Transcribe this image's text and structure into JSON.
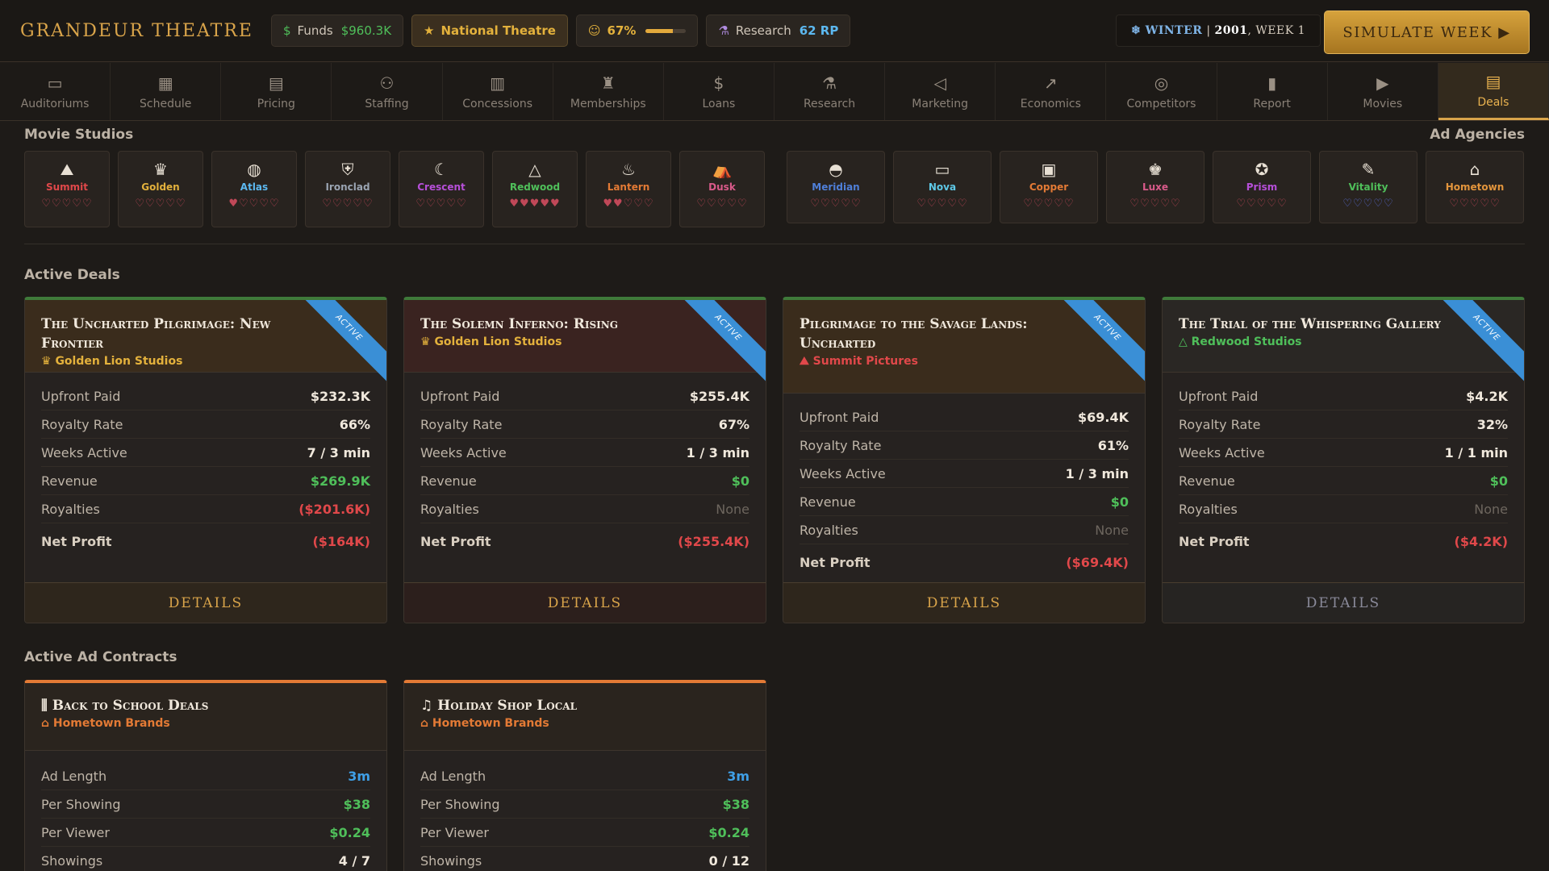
{
  "header": {
    "brand": "GRANDEUR THEATRE",
    "funds_label": "Funds",
    "funds_value": "$960.3K",
    "tier": "National Theatre",
    "satisfaction": "67%",
    "satisfaction_level": 0.67,
    "research_label": "Research",
    "research_value": "62 RP",
    "season": "WINTER",
    "year": "2001",
    "week": ", WEEK 1",
    "simulate_label": "SIMULATE WEEK ▶"
  },
  "nav": [
    {
      "label": "Auditoriums",
      "icon": "sofa-icon"
    },
    {
      "label": "Schedule",
      "icon": "calendar-icon"
    },
    {
      "label": "Pricing",
      "icon": "ticket-icon"
    },
    {
      "label": "Staffing",
      "icon": "people-icon"
    },
    {
      "label": "Concessions",
      "icon": "popcorn-icon"
    },
    {
      "label": "Memberships",
      "icon": "medal-icon"
    },
    {
      "label": "Loans",
      "icon": "dollar-icon"
    },
    {
      "label": "Research",
      "icon": "flask-icon"
    },
    {
      "label": "Marketing",
      "icon": "megaphone-icon"
    },
    {
      "label": "Economics",
      "icon": "chart-icon"
    },
    {
      "label": "Competitors",
      "icon": "target-icon"
    },
    {
      "label": "Report",
      "icon": "bars-icon"
    },
    {
      "label": "Movies",
      "icon": "play-icon"
    },
    {
      "label": "Deals",
      "icon": "document-icon",
      "active": true
    }
  ],
  "sections": {
    "studios": "Movie Studios",
    "agencies": "Ad Agencies",
    "deals": "Active Deals",
    "contracts": "Active Ad Contracts"
  },
  "studios": [
    {
      "name": "Summit",
      "color": "#e0484a",
      "hearts": "♡♡♡♡♡"
    },
    {
      "name": "Golden",
      "color": "#e3b13c",
      "hearts": "♡♡♡♡♡"
    },
    {
      "name": "Atlas",
      "color": "#5cb8f0",
      "hearts": "♥♡♡♡♡"
    },
    {
      "name": "Ironclad",
      "color": "#9aa4b2",
      "hearts": "♡♡♡♡♡"
    },
    {
      "name": "Crescent",
      "color": "#b64fd8",
      "hearts": "♡♡♡♡♡"
    },
    {
      "name": "Redwood",
      "color": "#4fbf5a",
      "hearts": "♥♥♥♥♥"
    },
    {
      "name": "Lantern",
      "color": "#e37a35",
      "hearts": "♥♥♡♡♡"
    },
    {
      "name": "Dusk",
      "color": "#d95a8a",
      "hearts": "♡♡♡♡♡"
    }
  ],
  "agencies": [
    {
      "name": "Meridian",
      "color": "#4f7fd8",
      "hearts": "♡♡♡♡♡"
    },
    {
      "name": "Nova",
      "color": "#5ec8e6",
      "hearts": "♡♡♡♡♡"
    },
    {
      "name": "Copper",
      "color": "#e37a35",
      "hearts": "♡♡♡♡♡"
    },
    {
      "name": "Luxe",
      "color": "#d95a8a",
      "hearts": "♡♡♡♡♡"
    },
    {
      "name": "Prism",
      "color": "#b64fd8",
      "hearts": "♡♡♡♡♡"
    },
    {
      "name": "Vitality",
      "color": "#4fbf5a",
      "hearts": "♡♡♡♡♡"
    },
    {
      "name": "Hometown",
      "color": "#e3953c",
      "hearts": "♡♡♡♡♡"
    }
  ],
  "deals": [
    {
      "title": "The Uncharted Pilgrimage: New Frontier",
      "studio": "Golden Lion Studios",
      "ribbon": "ACTIVE",
      "rows": [
        [
          "Upfront Paid",
          "$232.3K"
        ],
        [
          "Royalty Rate",
          "66%"
        ],
        [
          "Weeks Active",
          "7 / 3 min"
        ],
        [
          "Revenue",
          "$269.9K"
        ],
        [
          "Royalties",
          "($201.6K)"
        ]
      ],
      "net_label": "Net Profit",
      "net_value": "($164K)",
      "details": "DETAILS"
    },
    {
      "title": "The Solemn Inferno: Rising",
      "studio": "Golden Lion Studios",
      "ribbon": "ACTIVE",
      "rows": [
        [
          "Upfront Paid",
          "$255.4K"
        ],
        [
          "Royalty Rate",
          "67%"
        ],
        [
          "Weeks Active",
          "1 / 3 min"
        ],
        [
          "Revenue",
          "$0"
        ],
        [
          "Royalties",
          "None"
        ]
      ],
      "net_label": "Net Profit",
      "net_value": "($255.4K)",
      "details": "DETAILS"
    },
    {
      "title": "Pilgrimage to the Savage Lands: Uncharted",
      "studio": "Summit Pictures",
      "ribbon": "ACTIVE",
      "rows": [
        [
          "Upfront Paid",
          "$69.4K"
        ],
        [
          "Royalty Rate",
          "61%"
        ],
        [
          "Weeks Active",
          "1 / 3 min"
        ],
        [
          "Revenue",
          "$0"
        ],
        [
          "Royalties",
          "None"
        ]
      ],
      "net_label": "Net Profit",
      "net_value": "($69.4K)",
      "details": "DETAILS"
    },
    {
      "title": "The Trial of the Whispering Gallery",
      "studio": "Redwood Studios",
      "ribbon": "ACTIVE",
      "rows": [
        [
          "Upfront Paid",
          "$4.2K"
        ],
        [
          "Royalty Rate",
          "32%"
        ],
        [
          "Weeks Active",
          "1 / 1 min"
        ],
        [
          "Revenue",
          "$0"
        ],
        [
          "Royalties",
          "None"
        ]
      ],
      "net_label": "Net Profit",
      "net_value": "($4.2K)",
      "details": "DETAILS"
    }
  ],
  "contracts": [
    {
      "title": "Back to School Deals",
      "agency": "Hometown Brands",
      "rows": [
        [
          "Ad Length",
          "3m"
        ],
        [
          "Per Showing",
          "$38"
        ],
        [
          "Per Viewer",
          "$0.24"
        ],
        [
          "Showings",
          "4 / 7"
        ]
      ]
    },
    {
      "title": "Holiday Shop Local",
      "agency": "Hometown Brands",
      "rows": [
        [
          "Ad Length",
          "3m"
        ],
        [
          "Per Showing",
          "$38"
        ],
        [
          "Per Viewer",
          "$0.24"
        ],
        [
          "Showings",
          "0 / 12"
        ]
      ]
    }
  ]
}
